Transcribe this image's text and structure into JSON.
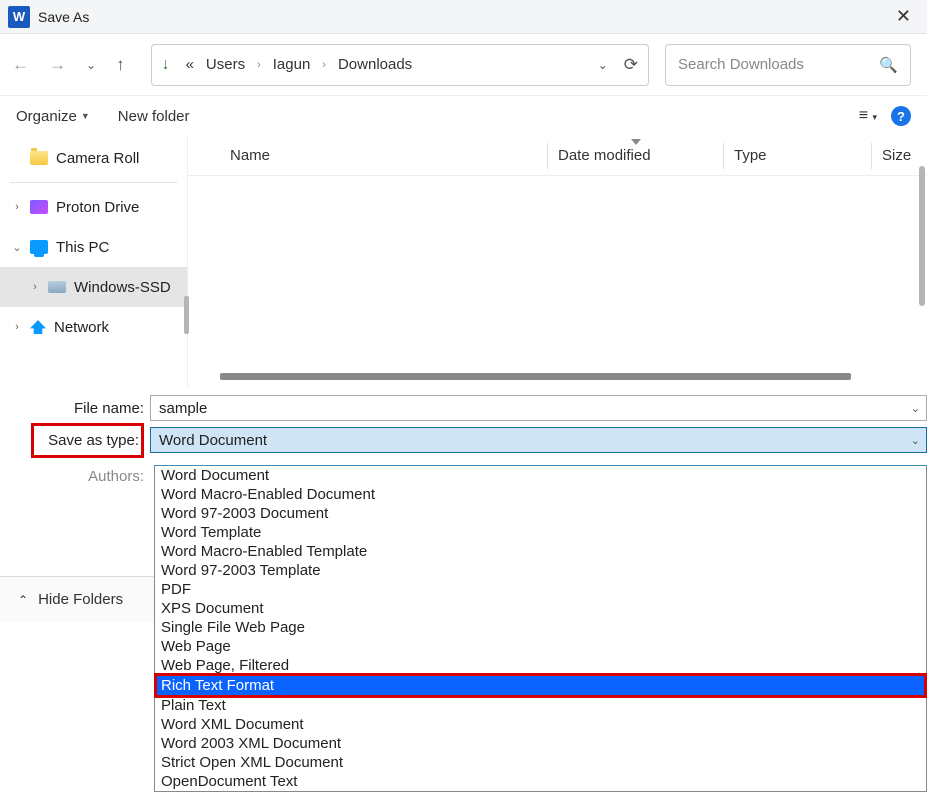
{
  "titlebar": {
    "title": "Save As"
  },
  "breadcrumb": {
    "p1": "Users",
    "p2": "Iagun",
    "p3": "Downloads"
  },
  "search": {
    "placeholder": "Search Downloads"
  },
  "toolbar": {
    "organize": "Organize",
    "newfolder": "New folder"
  },
  "sidebar": {
    "camera": "Camera Roll",
    "proton": "Proton Drive",
    "thispc": "This PC",
    "winssd": "Windows-SSD",
    "network": "Network"
  },
  "columns": {
    "name": "Name",
    "date": "Date modified",
    "type": "Type",
    "size": "Size"
  },
  "form": {
    "filename_label": "File name:",
    "filename_value": "sample",
    "savetype_label": "Save as type:",
    "savetype_value": "Word Document",
    "authors_label": "Authors:"
  },
  "types": {
    "o0": "Word Document",
    "o1": "Word Macro-Enabled Document",
    "o2": "Word 97-2003 Document",
    "o3": "Word Template",
    "o4": "Word Macro-Enabled Template",
    "o5": "Word 97-2003 Template",
    "o6": "PDF",
    "o7": "XPS Document",
    "o8": "Single File Web Page",
    "o9": "Web Page",
    "o10": "Web Page, Filtered",
    "o11": "Rich Text Format",
    "o12": "Plain Text",
    "o13": "Word XML Document",
    "o14": "Word 2003 XML Document",
    "o15": "Strict Open XML Document",
    "o16": "OpenDocument Text"
  },
  "bottom": {
    "hide": "Hide Folders"
  }
}
